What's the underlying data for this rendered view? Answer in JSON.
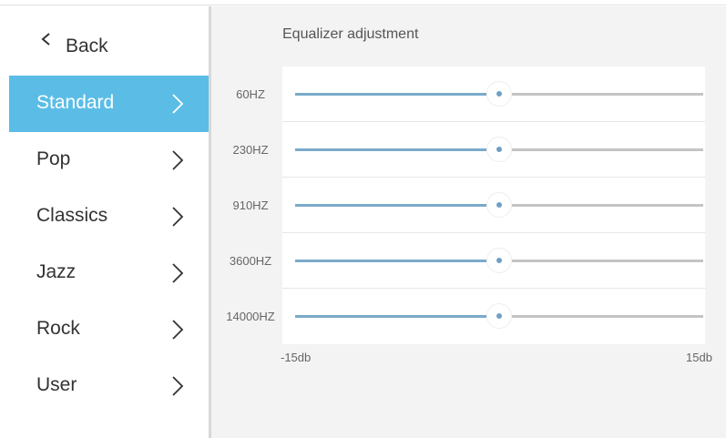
{
  "nav": {
    "back_label": "Back",
    "items": [
      {
        "label": "Standard",
        "active": true
      },
      {
        "label": "Pop",
        "active": false
      },
      {
        "label": "Classics",
        "active": false
      },
      {
        "label": "Jazz",
        "active": false
      },
      {
        "label": "Rock",
        "active": false
      },
      {
        "label": "User",
        "active": false
      }
    ]
  },
  "equalizer": {
    "title": "Equalizer adjustment",
    "min_label": "-15db",
    "max_label": "15db",
    "min_db": -15,
    "max_db": 15,
    "bands": [
      {
        "label": "60HZ",
        "value_db": 0
      },
      {
        "label": "230HZ",
        "value_db": 0
      },
      {
        "label": "910HZ",
        "value_db": 0
      },
      {
        "label": "3600HZ",
        "value_db": 0
      },
      {
        "label": "14000HZ",
        "value_db": 0
      }
    ]
  },
  "colors": {
    "accent": "#5bbde6",
    "track_filled": "#7aaac9",
    "track_empty": "#c4c4c4"
  }
}
